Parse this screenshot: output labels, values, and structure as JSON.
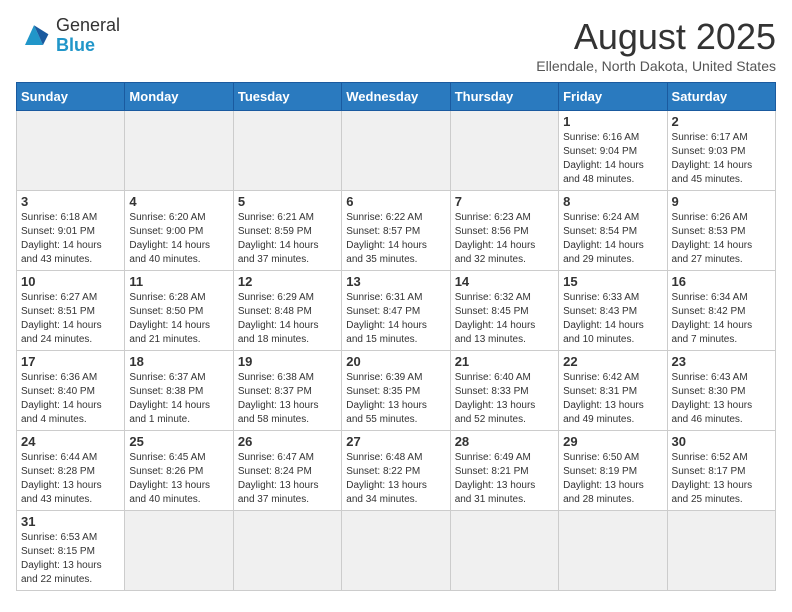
{
  "header": {
    "logo_general": "General",
    "logo_blue": "Blue",
    "title": "August 2025",
    "subtitle": "Ellendale, North Dakota, United States"
  },
  "weekdays": [
    "Sunday",
    "Monday",
    "Tuesday",
    "Wednesday",
    "Thursday",
    "Friday",
    "Saturday"
  ],
  "weeks": [
    [
      {
        "day": "",
        "info": ""
      },
      {
        "day": "",
        "info": ""
      },
      {
        "day": "",
        "info": ""
      },
      {
        "day": "",
        "info": ""
      },
      {
        "day": "",
        "info": ""
      },
      {
        "day": "1",
        "info": "Sunrise: 6:16 AM\nSunset: 9:04 PM\nDaylight: 14 hours and 48 minutes."
      },
      {
        "day": "2",
        "info": "Sunrise: 6:17 AM\nSunset: 9:03 PM\nDaylight: 14 hours and 45 minutes."
      }
    ],
    [
      {
        "day": "3",
        "info": "Sunrise: 6:18 AM\nSunset: 9:01 PM\nDaylight: 14 hours and 43 minutes."
      },
      {
        "day": "4",
        "info": "Sunrise: 6:20 AM\nSunset: 9:00 PM\nDaylight: 14 hours and 40 minutes."
      },
      {
        "day": "5",
        "info": "Sunrise: 6:21 AM\nSunset: 8:59 PM\nDaylight: 14 hours and 37 minutes."
      },
      {
        "day": "6",
        "info": "Sunrise: 6:22 AM\nSunset: 8:57 PM\nDaylight: 14 hours and 35 minutes."
      },
      {
        "day": "7",
        "info": "Sunrise: 6:23 AM\nSunset: 8:56 PM\nDaylight: 14 hours and 32 minutes."
      },
      {
        "day": "8",
        "info": "Sunrise: 6:24 AM\nSunset: 8:54 PM\nDaylight: 14 hours and 29 minutes."
      },
      {
        "day": "9",
        "info": "Sunrise: 6:26 AM\nSunset: 8:53 PM\nDaylight: 14 hours and 27 minutes."
      }
    ],
    [
      {
        "day": "10",
        "info": "Sunrise: 6:27 AM\nSunset: 8:51 PM\nDaylight: 14 hours and 24 minutes."
      },
      {
        "day": "11",
        "info": "Sunrise: 6:28 AM\nSunset: 8:50 PM\nDaylight: 14 hours and 21 minutes."
      },
      {
        "day": "12",
        "info": "Sunrise: 6:29 AM\nSunset: 8:48 PM\nDaylight: 14 hours and 18 minutes."
      },
      {
        "day": "13",
        "info": "Sunrise: 6:31 AM\nSunset: 8:47 PM\nDaylight: 14 hours and 15 minutes."
      },
      {
        "day": "14",
        "info": "Sunrise: 6:32 AM\nSunset: 8:45 PM\nDaylight: 14 hours and 13 minutes."
      },
      {
        "day": "15",
        "info": "Sunrise: 6:33 AM\nSunset: 8:43 PM\nDaylight: 14 hours and 10 minutes."
      },
      {
        "day": "16",
        "info": "Sunrise: 6:34 AM\nSunset: 8:42 PM\nDaylight: 14 hours and 7 minutes."
      }
    ],
    [
      {
        "day": "17",
        "info": "Sunrise: 6:36 AM\nSunset: 8:40 PM\nDaylight: 14 hours and 4 minutes."
      },
      {
        "day": "18",
        "info": "Sunrise: 6:37 AM\nSunset: 8:38 PM\nDaylight: 14 hours and 1 minute."
      },
      {
        "day": "19",
        "info": "Sunrise: 6:38 AM\nSunset: 8:37 PM\nDaylight: 13 hours and 58 minutes."
      },
      {
        "day": "20",
        "info": "Sunrise: 6:39 AM\nSunset: 8:35 PM\nDaylight: 13 hours and 55 minutes."
      },
      {
        "day": "21",
        "info": "Sunrise: 6:40 AM\nSunset: 8:33 PM\nDaylight: 13 hours and 52 minutes."
      },
      {
        "day": "22",
        "info": "Sunrise: 6:42 AM\nSunset: 8:31 PM\nDaylight: 13 hours and 49 minutes."
      },
      {
        "day": "23",
        "info": "Sunrise: 6:43 AM\nSunset: 8:30 PM\nDaylight: 13 hours and 46 minutes."
      }
    ],
    [
      {
        "day": "24",
        "info": "Sunrise: 6:44 AM\nSunset: 8:28 PM\nDaylight: 13 hours and 43 minutes."
      },
      {
        "day": "25",
        "info": "Sunrise: 6:45 AM\nSunset: 8:26 PM\nDaylight: 13 hours and 40 minutes."
      },
      {
        "day": "26",
        "info": "Sunrise: 6:47 AM\nSunset: 8:24 PM\nDaylight: 13 hours and 37 minutes."
      },
      {
        "day": "27",
        "info": "Sunrise: 6:48 AM\nSunset: 8:22 PM\nDaylight: 13 hours and 34 minutes."
      },
      {
        "day": "28",
        "info": "Sunrise: 6:49 AM\nSunset: 8:21 PM\nDaylight: 13 hours and 31 minutes."
      },
      {
        "day": "29",
        "info": "Sunrise: 6:50 AM\nSunset: 8:19 PM\nDaylight: 13 hours and 28 minutes."
      },
      {
        "day": "30",
        "info": "Sunrise: 6:52 AM\nSunset: 8:17 PM\nDaylight: 13 hours and 25 minutes."
      }
    ],
    [
      {
        "day": "31",
        "info": "Sunrise: 6:53 AM\nSunset: 8:15 PM\nDaylight: 13 hours and 22 minutes."
      },
      {
        "day": "",
        "info": ""
      },
      {
        "day": "",
        "info": ""
      },
      {
        "day": "",
        "info": ""
      },
      {
        "day": "",
        "info": ""
      },
      {
        "day": "",
        "info": ""
      },
      {
        "day": "",
        "info": ""
      }
    ]
  ]
}
